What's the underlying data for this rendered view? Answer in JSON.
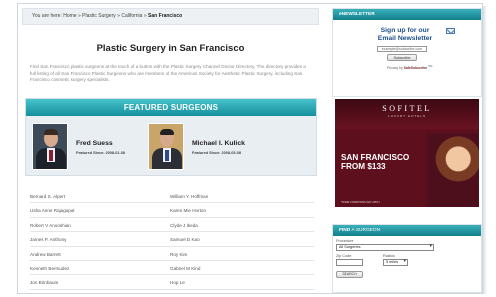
{
  "breadcrumb": {
    "prefix": "You are here:",
    "home": "Home",
    "sep": "»",
    "level1": "Plastic Surgery",
    "level2": "California",
    "current": "San Francisco"
  },
  "page_title": "Plastic Surgery in San Francisco",
  "intro": "Find San Francisco plastic surgeons at the touch of a button with the Plastic Surgery Channel Doctor Directory. The directory provides a full listing of all San Francisco Plastic Surgeons who are members of the American Society for Aesthetic Plastic Surgery, including San Francisco cosmetic surgery specialists.",
  "featured": {
    "header": "FEATURED SURGEONS",
    "surgeons": [
      {
        "name": "Fred Suess",
        "since": "Featured Since: 2008-01-08"
      },
      {
        "name": "Michael I. Kulick",
        "since": "Featured Since: 2008-05-08"
      }
    ]
  },
  "surgeon_list": [
    [
      "Bernard S. Alpert",
      "William Y. Hoffman"
    ],
    [
      "Usha Anne Rajagopal",
      "Karen Mie Horton"
    ],
    [
      "Robert V Anooshian",
      "Clyde J Ikeda"
    ],
    [
      "James P. Anthony",
      "Samuel D Kao"
    ],
    [
      "Andrew Barrett",
      "Roy Kim"
    ],
    [
      "Kenneth Bermudez",
      "Gabriel M Kind"
    ],
    [
      "Jon Birnbaum",
      "Hop Le"
    ]
  ],
  "newsletter": {
    "header": "eNEWSLETTER",
    "title_line1": "Sign up for our",
    "title_line2": "Email Newsletter",
    "input_value": "example@subscribe.com",
    "button": "Subscribe",
    "safe_prefix": "Privacy by",
    "safe_brand": "SafeSubscribe",
    "safe_suffix": "SM"
  },
  "ad": {
    "logo": "SOFITEL",
    "subtitle": "LUXURY HOTELS",
    "line1": "SAN FRANCISCO",
    "line2": "FROM $133",
    "fine": "*SOME CONDITIONS MAY APPLY"
  },
  "find": {
    "header_bold": "FIND",
    "header_light": "A SURGEON",
    "procedure_label": "Procedure",
    "procedure_value": "All Surgeries",
    "zip_label": "Zip Code",
    "radius_label": "Radius",
    "radius_value": "5 miles",
    "search_button": "SEARCH"
  },
  "icons": {
    "newsletter": "envelope-icon",
    "select": "chevron-down-icon"
  },
  "colors": {
    "accent_teal": "#1a97a3",
    "link_blue": "#1d4f8a",
    "ad_background": "#5e0f1d"
  }
}
